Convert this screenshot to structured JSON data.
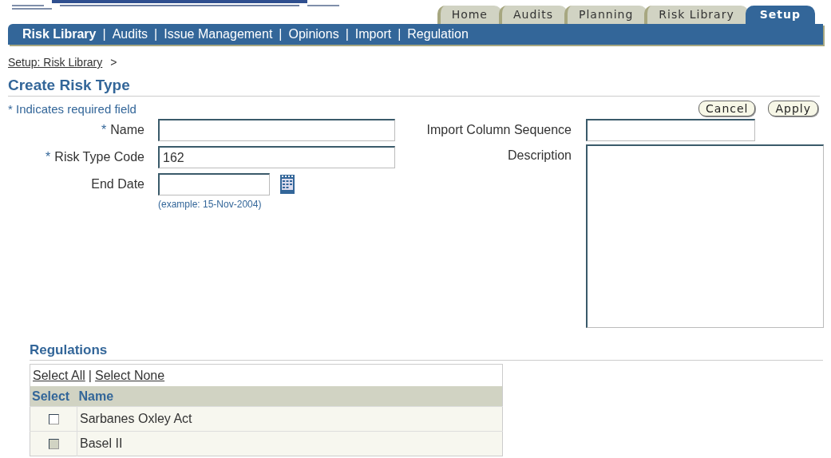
{
  "tabs": [
    {
      "label": "Home",
      "selected": false
    },
    {
      "label": "Audits",
      "selected": false
    },
    {
      "label": "Planning",
      "selected": false
    },
    {
      "label": "Risk Library",
      "selected": false
    },
    {
      "label": "Setup",
      "selected": true
    }
  ],
  "subnav": [
    {
      "label": "Risk Library",
      "selected": true
    },
    {
      "label": "Audits",
      "selected": false,
      "separator": "|"
    },
    {
      "label": "Issue Management",
      "selected": false,
      "separator": "|"
    },
    {
      "label": "Opinions",
      "selected": false,
      "separator": "|"
    },
    {
      "label": "Import",
      "selected": false,
      "separator": "|"
    },
    {
      "label": "Regulation",
      "selected": false,
      "separator": "|"
    }
  ],
  "breadcrumb": {
    "link": "Setup: Risk Library",
    "separator": ">"
  },
  "page_title": "Create Risk Type",
  "required_note": "* Indicates required field",
  "buttons": [
    "Cancel",
    "Apply"
  ],
  "fields_left": [
    {
      "label": "Name",
      "required_mark": "*",
      "kind": "text"
    },
    {
      "label": "Risk Type Code",
      "required_mark": "*",
      "value": "162",
      "kind": "text"
    },
    {
      "label": "End Date",
      "kind": "date",
      "hint": "(example: 15-Nov-2004)"
    }
  ],
  "fields_right": [
    {
      "label": "Import Column Sequence",
      "kind": "text"
    },
    {
      "label": "Description",
      "kind": "textarea"
    }
  ],
  "regulations": {
    "title": "Regulations",
    "select_all": "Select All",
    "separator": "|",
    "select_none": "Select None",
    "columns": [
      "Select",
      "Name"
    ],
    "rows": [
      {
        "name": "Sarbanes Oxley Act",
        "checked": false,
        "disabled": false
      },
      {
        "name": "Basel II",
        "checked": false,
        "disabled": true
      }
    ]
  }
}
